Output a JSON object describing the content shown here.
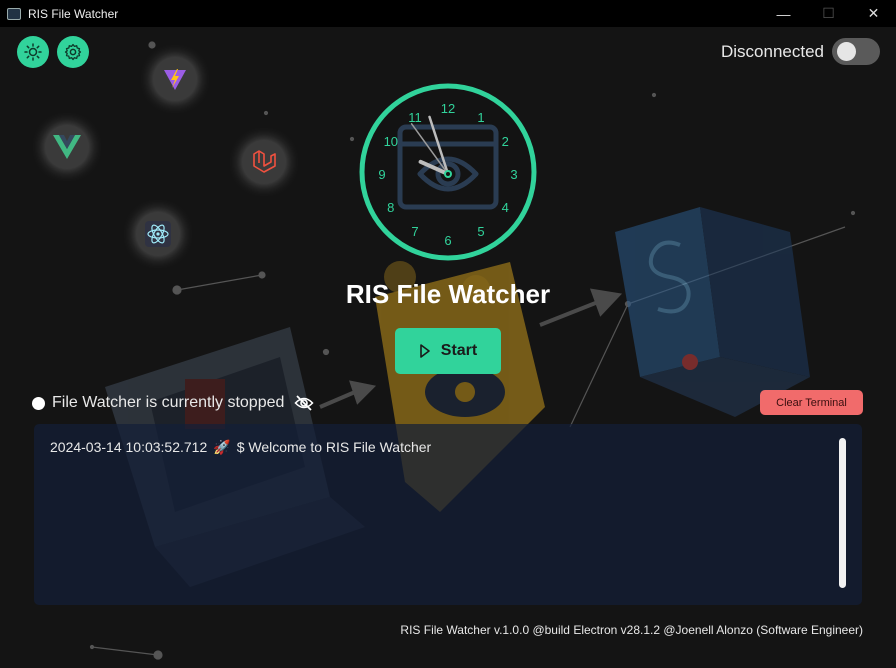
{
  "window": {
    "title": "RIS File Watcher",
    "minimize_glyph": "—",
    "maximize_glyph": "☐",
    "close_glyph": "✕"
  },
  "header": {
    "theme_button_icon": "sun-icon",
    "settings_button_icon": "gear-icon",
    "connection_label": "Disconnected",
    "connection_on": false
  },
  "tech_icons": [
    "vite-icon",
    "vue-icon",
    "laravel-icon",
    "electron-icon"
  ],
  "clock": {
    "numbers": [
      "12",
      "1",
      "2",
      "3",
      "4",
      "5",
      "6",
      "7",
      "8",
      "9",
      "10",
      "11"
    ],
    "hour_hand_hour": 9.8,
    "minute_hand_minute": 57,
    "second_hand_second": 54
  },
  "main": {
    "app_title": "RIS File Watcher",
    "start_label": "Start",
    "status_text": "File Watcher is currently stopped",
    "clear_terminal_label": "Clear Terminal"
  },
  "terminal": {
    "lines": [
      {
        "timestamp": "2024-03-14 10:03:52.712",
        "icon": "🚀",
        "text": "$ Welcome to RIS File Watcher"
      }
    ]
  },
  "footer": {
    "text": "RIS File Watcher v.1.0.0 @build Electron v28.1.2 @Joenell Alonzo (Software Engineer)"
  },
  "colors": {
    "accent": "#31d39b",
    "danger": "#f16b6b",
    "background": "#141414",
    "terminal_bg": "#141e37"
  }
}
